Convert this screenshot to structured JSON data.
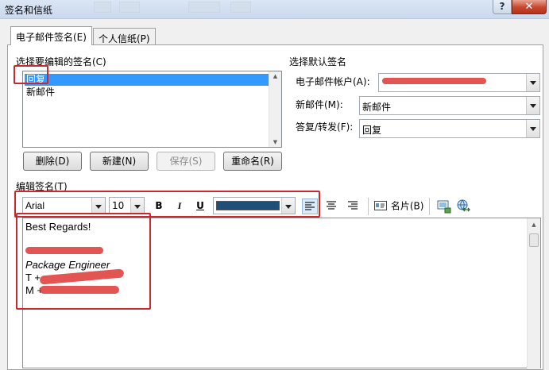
{
  "window": {
    "title": "签名和信纸",
    "help_label": "?",
    "close_label": "✕"
  },
  "tabs": [
    {
      "label": "电子邮件签名(E)",
      "active": true
    },
    {
      "label": "个人信纸(P)",
      "active": false
    }
  ],
  "select_signature": {
    "heading": "选择要编辑的签名(C)",
    "items": [
      {
        "label": "回复",
        "selected": true
      },
      {
        "label": "新邮件",
        "selected": false
      }
    ],
    "buttons": {
      "delete": "删除(D)",
      "new": "新建(N)",
      "save": "保存(S)",
      "rename": "重命名(R)"
    }
  },
  "default_signature": {
    "heading": "选择默认签名",
    "account_label": "电子邮件帐户(A):",
    "new_messages_label": "新邮件(M):",
    "new_messages_value": "新邮件",
    "replies_label": "答复/转发(F):",
    "replies_value": "回复"
  },
  "editor": {
    "heading": "编辑签名(T)",
    "font": "Arial",
    "size": "10",
    "bold_icon": "B",
    "italic_icon": "I",
    "underline_icon": "U",
    "color_value": "#1f4e79",
    "business_card_label": "名片(B)",
    "signature_lines": [
      "Best Regards!",
      "Package Engineer",
      "T +",
      "M +"
    ]
  },
  "colors": {
    "selection": "#3399ff",
    "annotation_red": "#c8282f"
  }
}
